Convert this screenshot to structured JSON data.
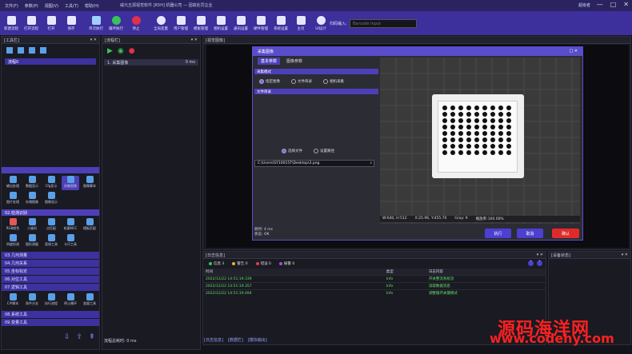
{
  "app": {
    "menu": [
      "文件(F)",
      "参数(P)",
      "视图(V)",
      "工具(T)",
      "帮助(H)"
    ],
    "title": "威元五源视觉软件 [R5H]    机器公司 — 因故处罚企业",
    "user": "超级者",
    "window_controls": [
      "—",
      "□",
      "✕"
    ]
  },
  "toolbar": {
    "items": [
      {
        "label": "新建流程",
        "icon": "new-icon"
      },
      {
        "label": "打开流程",
        "icon": "open-icon"
      },
      {
        "label": "打开",
        "icon": "folder-icon"
      },
      {
        "label": "保存",
        "icon": "save-icon"
      },
      {
        "label": "单次执行",
        "icon": "run-once-icon"
      },
      {
        "label": "循环执行",
        "icon": "loop-icon"
      },
      {
        "label": "停止",
        "icon": "stop-icon"
      },
      {
        "label": "全局变量",
        "icon": "globe-icon"
      },
      {
        "label": "用户管理",
        "icon": "user-icon"
      },
      {
        "label": "模板管理",
        "icon": "template-icon"
      },
      {
        "label": "相机设置",
        "icon": "camera-icon"
      },
      {
        "label": "通讯设置",
        "icon": "comm-icon"
      },
      {
        "label": "硬件管理",
        "icon": "hardware-icon"
      },
      {
        "label": "系统设置",
        "icon": "settings-icon"
      },
      {
        "label": "主页",
        "icon": "home-icon"
      },
      {
        "label": "UI设计",
        "icon": "ui-icon"
      }
    ],
    "scan_label": "扫码输入:",
    "barcode_placeholder": "Barcode Input"
  },
  "tool_panel": {
    "title": "[工具栏]",
    "tree_item": "流程0",
    "tools_a": [
      {
        "label": "输出处理"
      },
      {
        "label": "数据显示"
      },
      {
        "label": "Cfg显示"
      },
      {
        "label": "采集图像"
      },
      {
        "label": "图像脚本"
      }
    ],
    "tools_b": [
      {
        "label": "图片处理"
      },
      {
        "label": "存储图像"
      },
      {
        "label": "图像显示"
      }
    ],
    "section_detect": "02.检测识别",
    "tools_c": [
      {
        "label": "RGB颜色"
      },
      {
        "label": "二维码"
      },
      {
        "label": "点匹配"
      },
      {
        "label": "轮廓NCC"
      },
      {
        "label": "模板匹配"
      }
    ],
    "tools_d": [
      {
        "label": "四度检测"
      },
      {
        "label": "图形测量"
      },
      {
        "label": "直线工具"
      },
      {
        "label": "卡尺工具"
      }
    ],
    "sections": [
      "03.几何测量",
      "04.几何关系",
      "05.坐标标定",
      "06.对位工具",
      "07.逻辑工具"
    ],
    "tools_e": [
      {
        "label": "C#脚本"
      },
      {
        "label": "条件分支"
      },
      {
        "label": "执行流程"
      },
      {
        "label": "停止循环"
      },
      {
        "label": "变量工具"
      }
    ],
    "sections_bottom": [
      "08.系统工具",
      "09.变量工具"
    ]
  },
  "flow_panel": {
    "title": "[流程栏]",
    "item": "1. 采集图像",
    "item_time": "0 ms",
    "footer": "流程总耗时: 0  ms"
  },
  "image_panel": {
    "title": "[视觉图像]"
  },
  "dialog": {
    "title": "采集图像",
    "tabs": [
      "基本参数",
      "图像参数"
    ],
    "section_mode": "采集模式",
    "modes": [
      "指定图像",
      "文件目录",
      "相机采集"
    ],
    "section_file": "文件目录",
    "file_options": [
      "选择文件",
      "设置路径"
    ],
    "path": "C:\\Users\\SY10015T\\Desktop\\3.png",
    "elapsed": "耗时: 4 ms",
    "status": "状态: OK",
    "image_status": [
      "W:640, H:512",
      "X:25.96, Y:455.70",
      "Gray: 9",
      "缩放率:100.00%"
    ],
    "buttons": [
      "执行",
      "取消",
      "确认"
    ]
  },
  "log_panel": {
    "title": "[日志信息]",
    "filters": [
      {
        "label": "信息 3",
        "color": "#35c46a"
      },
      {
        "label": "警告 0",
        "color": "#f0b02c"
      },
      {
        "label": "错误 0",
        "color": "#e0404a"
      },
      {
        "label": "报警 0",
        "color": "#b04adf"
      }
    ],
    "columns": [
      "时间",
      "类型",
      "日志内容"
    ],
    "rows": [
      [
        "2022/12/22 14:51:19.339",
        "Info",
        "开关整流系统流"
      ],
      [
        "2022/12/22 14:51:19.357",
        "Info",
        "读取数据消息"
      ],
      [
        "2022/12/22 14:51:19.494",
        "Info",
        "调整循环关键模式"
      ]
    ]
  },
  "status_panel": {
    "title": "[设备状态]"
  },
  "bottom_tabs": [
    "[日志信息]",
    "[数据栏]",
    "[模块输出]"
  ],
  "watermark": {
    "line1": "源码海洋网",
    "line2": "www.codehy.com"
  }
}
